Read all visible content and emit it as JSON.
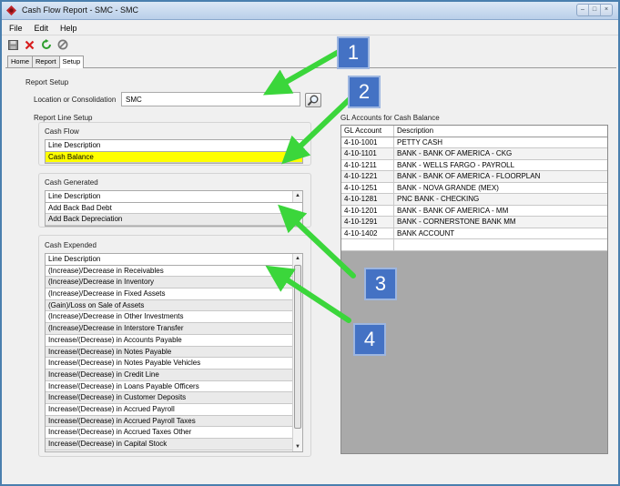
{
  "window": {
    "title": "Cash Flow Report - SMC - SMC"
  },
  "menu": [
    "File",
    "Edit",
    "Help"
  ],
  "toolbar": {
    "icons": [
      "save-icon",
      "delete-icon",
      "refresh-icon",
      "cancel-icon"
    ]
  },
  "tabs": [
    {
      "label": "Home"
    },
    {
      "label": "Report"
    },
    {
      "label": "Setup"
    }
  ],
  "setup": {
    "report_setup_label": "Report Setup",
    "location_label": "Location or Consolidation",
    "location_value": "SMC",
    "report_line_setup_label": "Report Line Setup",
    "cash_flow": {
      "label": "Cash Flow",
      "header": "Line Description",
      "rows": [
        "Cash Balance"
      ]
    },
    "cash_generated": {
      "label": "Cash Generated",
      "header": "Line Description",
      "rows": [
        "Add Back Bad Debt",
        "Add Back Depreciation"
      ]
    },
    "cash_expended": {
      "label": "Cash Expended",
      "header": "Line Description",
      "rows": [
        "(Increase)/Decrease in Receivables",
        "(Increase)/Decrease in Inventory",
        "(Increase)/Decrease in Fixed Assets",
        "(Gain)/Loss on Sale of Assets",
        "(Increase)/Decrease in Other Investments",
        "(Increase)/Decrease in Interstore Transfer",
        "Increase/(Decrease) in Accounts Payable",
        "Increase/(Decrease) in Notes Payable",
        "Increase/(Decrease) in Notes Payable Vehicles",
        "Increase/(Decrease) in Credit Line",
        "Increase/(Decrease) in Loans Payable Officers",
        "Increase/(Decrease) in Customer Deposits",
        "Increase/(Decrease) in Accrued Payroll",
        "Increase/(Decrease) in Accrued Payroll Taxes",
        "Increase/(Decrease) in Accrued Taxes Other",
        "Increase/(Decrease) in Capital Stock"
      ]
    },
    "gl_accounts": {
      "label": "GL Accounts for Cash Balance",
      "columns": [
        "GL Account",
        "Description"
      ],
      "rows": [
        [
          "4-10-1001",
          "PETTY CASH"
        ],
        [
          "4-10-1101",
          "BANK - BANK OF AMERICA - CKG"
        ],
        [
          "4-10-1211",
          "BANK - WELLS FARGO - PAYROLL"
        ],
        [
          "4-10-1221",
          "BANK - BANK OF AMERICA - FLOORPLAN"
        ],
        [
          "4-10-1251",
          "BANK - NOVA GRANDE (MEX)"
        ],
        [
          "4-10-1281",
          "PNC BANK - CHECKING"
        ],
        [
          "4-10-1201",
          "BANK - BANK OF AMERICA - MM"
        ],
        [
          "4-10-1291",
          "BANK - CORNERSTONE BANK MM"
        ],
        [
          "4-10-1402",
          "BANK ACCOUNT"
        ]
      ]
    }
  },
  "annotations": [
    {
      "label": "1"
    },
    {
      "label": "2"
    },
    {
      "label": "3"
    },
    {
      "label": "4"
    }
  ],
  "colors": {
    "selected_row": "#ffff00",
    "arrow": "#3bd63b",
    "badge": "#4472c4"
  }
}
